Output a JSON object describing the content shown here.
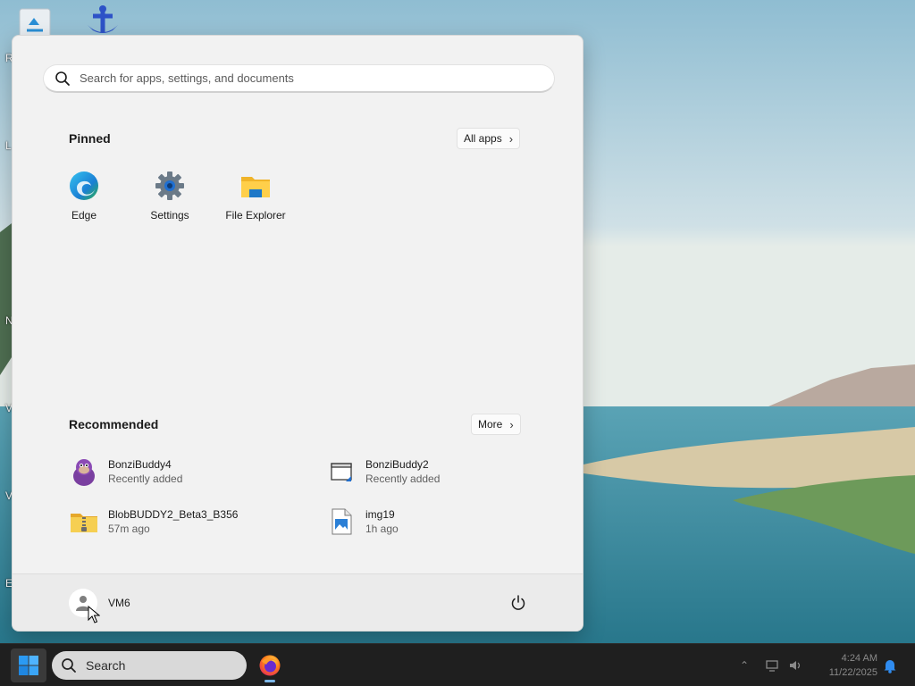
{
  "desktop": {
    "fragments": [
      "R",
      "L",
      "N",
      "V",
      "V",
      "E"
    ]
  },
  "start_menu": {
    "search_placeholder": "Search for apps, settings, and documents",
    "pinned": {
      "title": "Pinned",
      "all_apps_label": "All apps",
      "apps": [
        {
          "label": "Edge",
          "icon": "edge-icon"
        },
        {
          "label": "Settings",
          "icon": "settings-gear-icon"
        },
        {
          "label": "File Explorer",
          "icon": "folder-icon"
        }
      ]
    },
    "recommended": {
      "title": "Recommended",
      "more_label": "More",
      "items": [
        {
          "name": "BonziBuddy4",
          "sub": "Recently added",
          "icon": "bonzi-gorilla-icon"
        },
        {
          "name": "BonziBuddy2",
          "sub": "Recently added",
          "icon": "shortcut-window-icon"
        },
        {
          "name": "BlobBUDDY2_Beta3_B356",
          "sub": "57m ago",
          "icon": "zip-folder-icon"
        },
        {
          "name": "img19",
          "sub": "1h ago",
          "icon": "image-file-icon"
        }
      ]
    },
    "user": {
      "name": "VM6"
    }
  },
  "taskbar": {
    "search_label": "Search",
    "time": "4:24 AM",
    "date": "11/22/2025"
  },
  "colors": {
    "menu_bg": "#f2f2f2",
    "taskbar_bg": "#1f1f1f",
    "accent": "#0078d4"
  }
}
